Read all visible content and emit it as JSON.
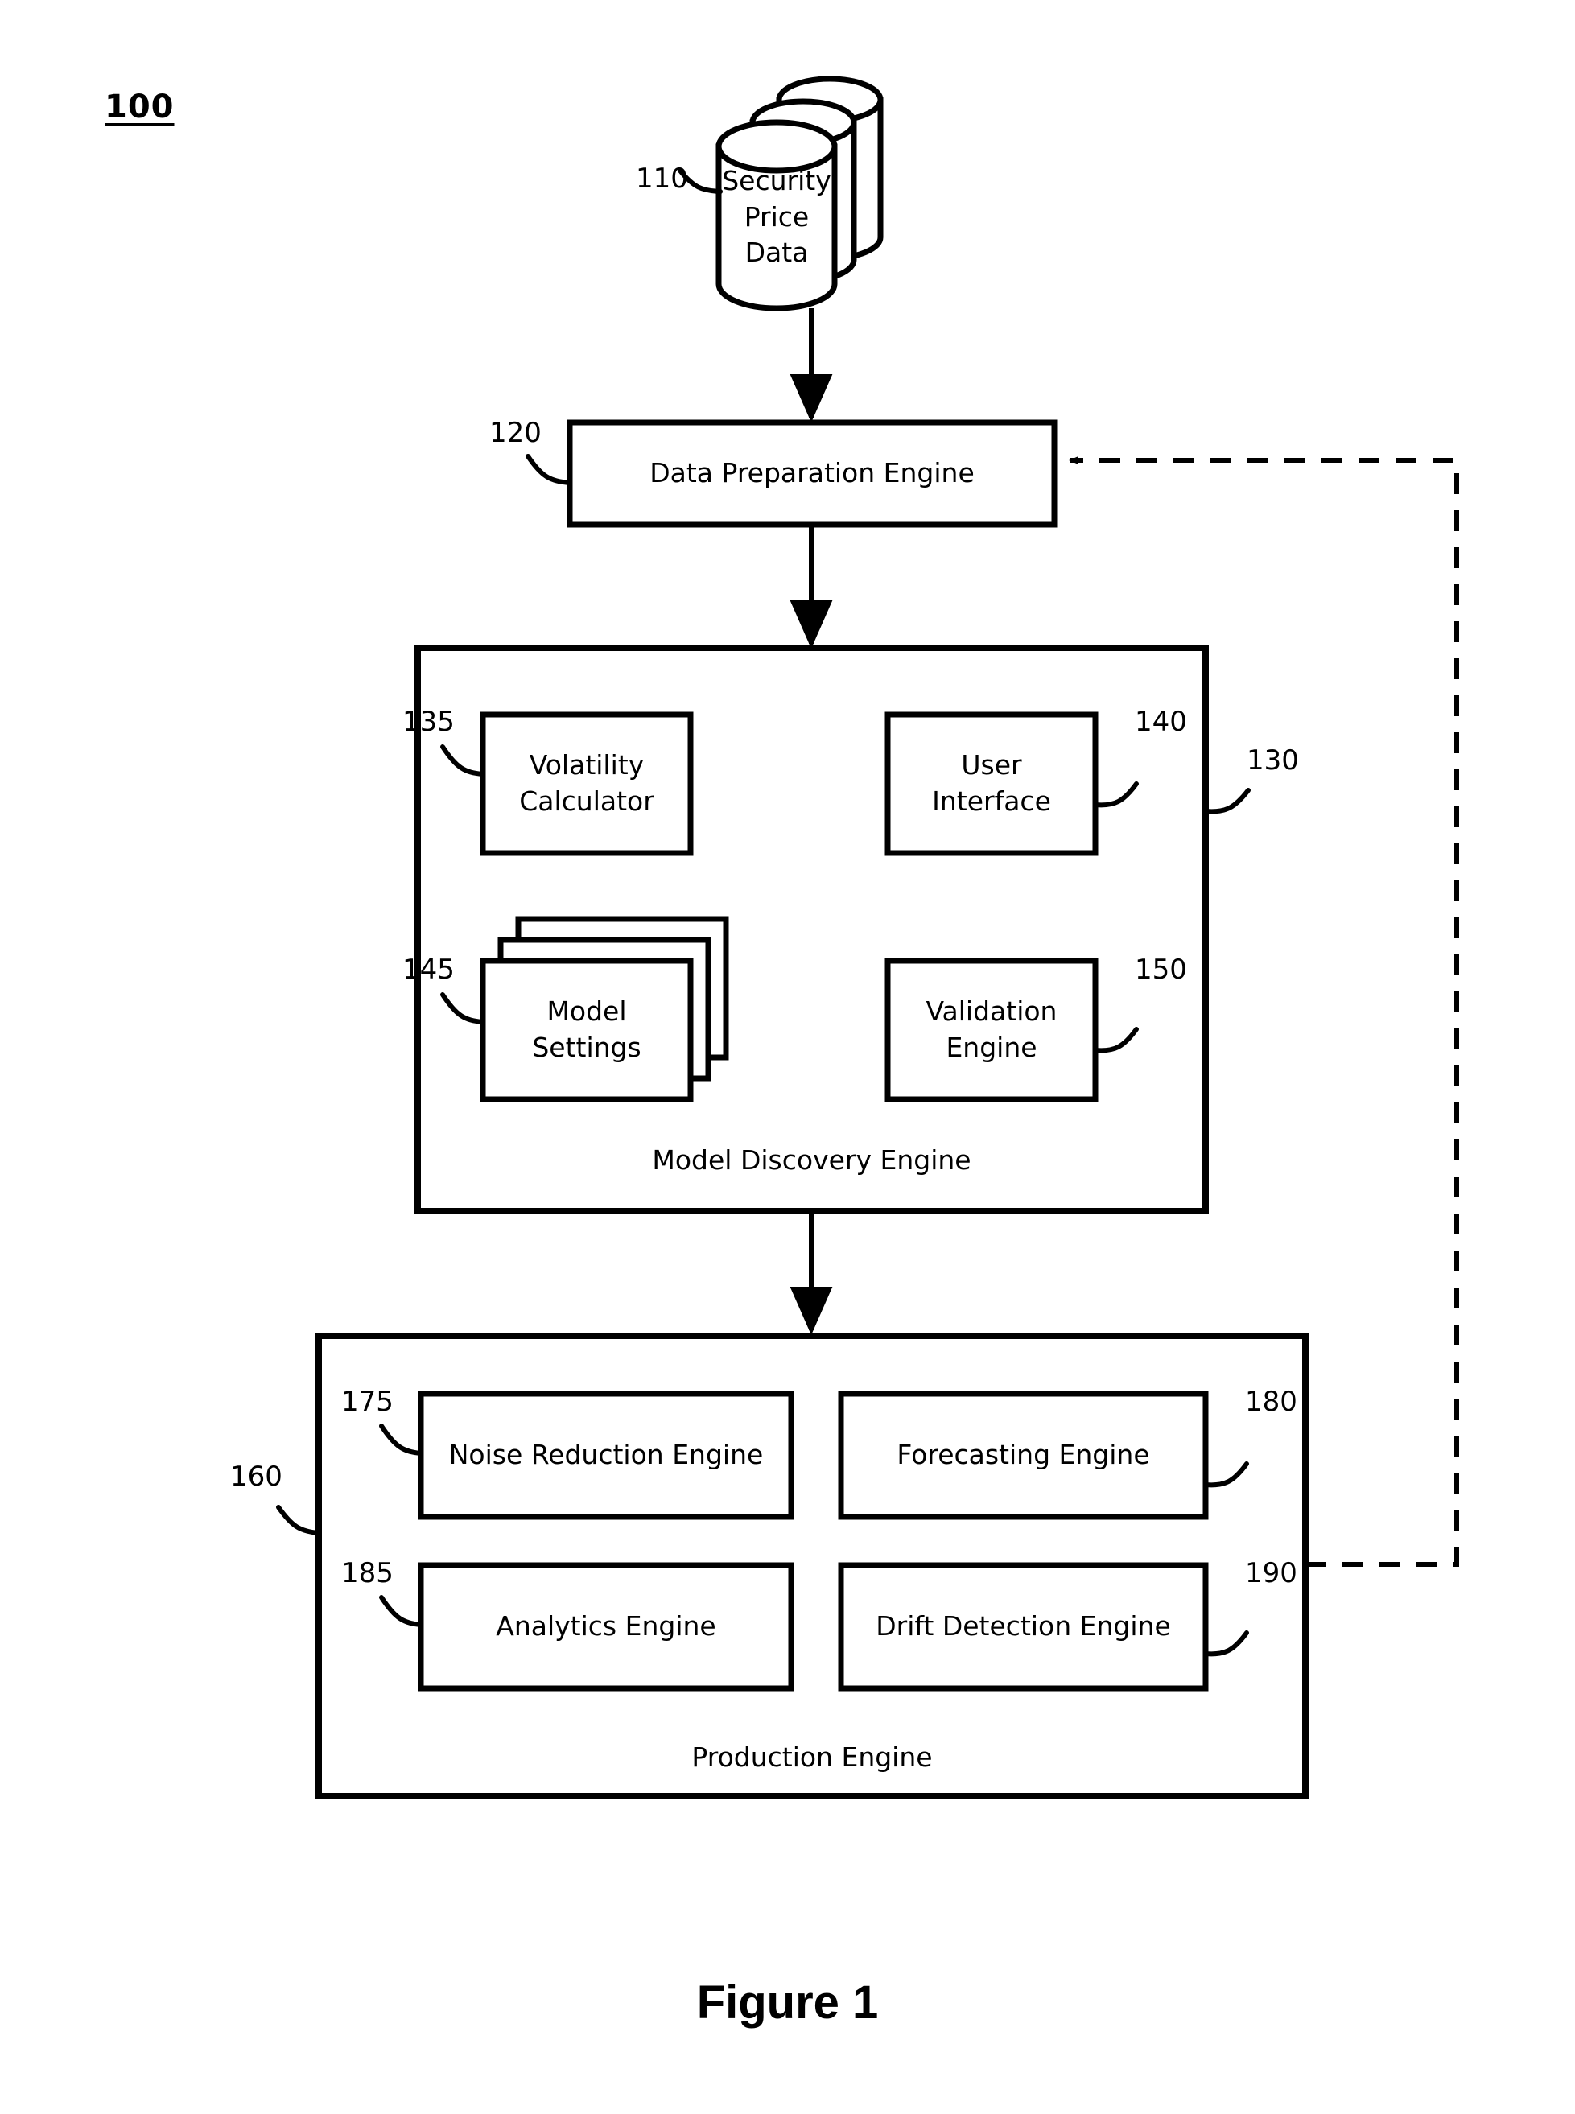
{
  "figure": {
    "system_number": "100",
    "caption": "Figure 1"
  },
  "nodes": {
    "datastore": {
      "ref": "110",
      "label": "Security\nPrice Data"
    },
    "data_preparation_engine": {
      "ref": "120",
      "label": "Data Preparation Engine"
    },
    "model_discovery_engine": {
      "ref": "130",
      "label": "Model Discovery Engine",
      "children": [
        {
          "ref": "135",
          "label": "Volatility\nCalculator"
        },
        {
          "ref": "140",
          "label": "User\nInterface"
        },
        {
          "ref": "145",
          "label": "Model\nSettings"
        },
        {
          "ref": "150",
          "label": "Validation\nEngine"
        }
      ]
    },
    "production_engine": {
      "ref": "160",
      "label": "Production Engine",
      "children": [
        {
          "ref": "175",
          "label": "Noise Reduction Engine"
        },
        {
          "ref": "180",
          "label": "Forecasting Engine"
        },
        {
          "ref": "185",
          "label": "Analytics Engine"
        },
        {
          "ref": "190",
          "label": "Drift Detection Engine"
        }
      ]
    }
  },
  "colors": {
    "stroke": "#000000",
    "background": "#ffffff"
  }
}
